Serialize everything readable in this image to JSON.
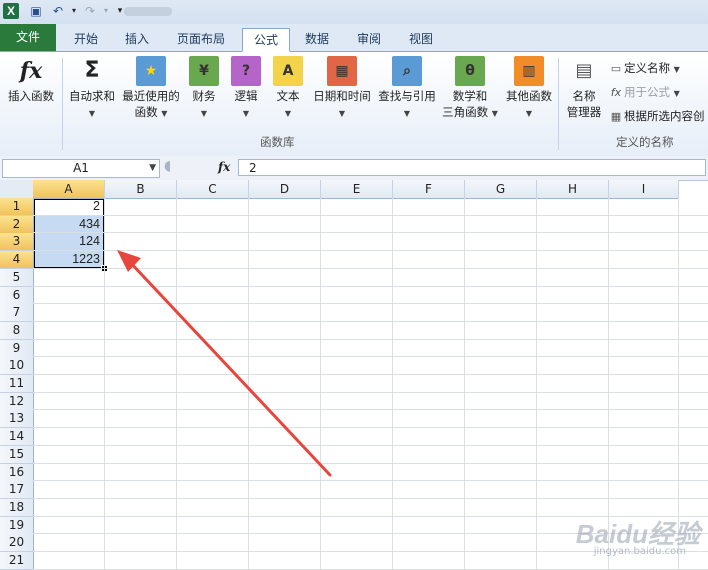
{
  "colors": {
    "file_tab": "#2a7a3b",
    "selection_header": "#f1c15f",
    "cell_highlight": "#c6dbf1",
    "arrow": "#e8453c"
  },
  "tabs": [
    {
      "label": "文件"
    },
    {
      "label": "开始"
    },
    {
      "label": "插入"
    },
    {
      "label": "页面布局"
    },
    {
      "label": "公式"
    },
    {
      "label": "数据"
    },
    {
      "label": "审阅"
    },
    {
      "label": "视图"
    }
  ],
  "ribbon": {
    "insert_function": {
      "line1": "插入函数",
      "icon": "fx-icon"
    },
    "autosum": {
      "line1": "自动求和",
      "icon": "sigma-icon"
    },
    "recent": {
      "line1": "最近使用的",
      "line2": "函数"
    },
    "financial": {
      "line1": "财务"
    },
    "logical": {
      "line1": "逻辑"
    },
    "text": {
      "line1": "文本"
    },
    "datetime": {
      "line1": "日期和时间"
    },
    "lookup": {
      "line1": "查找与引用"
    },
    "math": {
      "line1": "数学和",
      "line2": "三角函数"
    },
    "more": {
      "line1": "其他函数"
    },
    "group_function_library": "函数库",
    "name_manager": {
      "line1": "名称",
      "line2": "管理器"
    },
    "define_name": "定义名称",
    "use_in_formula": "用于公式",
    "create_from_selection": "根据所选内容创",
    "group_defined_names": "定义的名称"
  },
  "formula_bar": {
    "name_box": "A1",
    "fx": "fx",
    "value": "2"
  },
  "columns": [
    "A",
    "B",
    "C",
    "D",
    "E",
    "F",
    "G",
    "H",
    "I"
  ],
  "rows": [
    "1",
    "2",
    "3",
    "4",
    "5",
    "6",
    "7",
    "8",
    "9",
    "10",
    "11",
    "12",
    "13",
    "14",
    "15",
    "16",
    "17",
    "18",
    "19",
    "20",
    "21"
  ],
  "cells": {
    "A1": "2",
    "A2": "434",
    "A3": "124",
    "A4": "1223"
  },
  "watermark": {
    "brand": "Baidu经验",
    "url": "jingyan.baidu.com"
  }
}
